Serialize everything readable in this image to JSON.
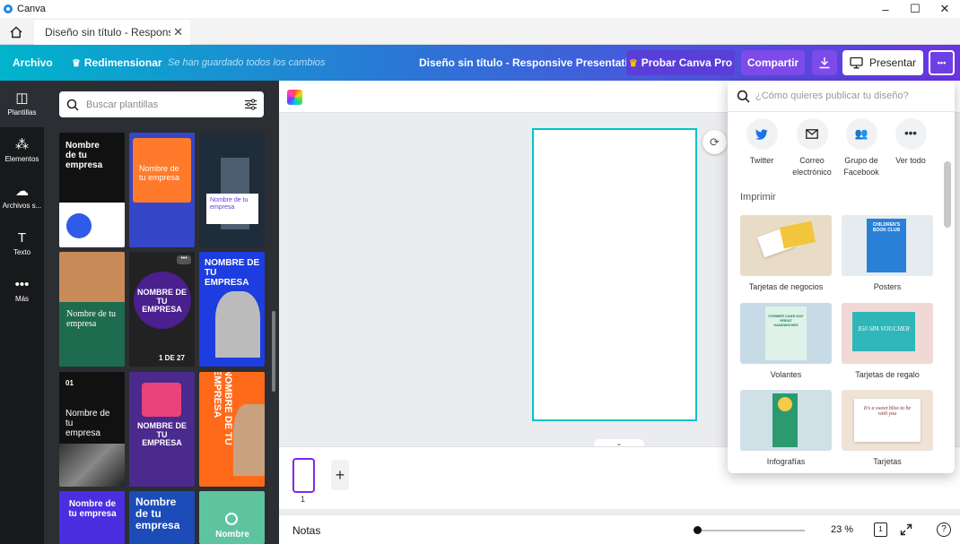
{
  "window": {
    "app_name": "Canva",
    "minimize": "–",
    "maximize": "☐",
    "close": "✕"
  },
  "tabbar": {
    "tab_title": "Diseño sin título - Responsive",
    "tab_close": "✕"
  },
  "topbar": {
    "file_menu": "Archivo",
    "resize": "Redimensionar",
    "saved_status": "Se han guardado todos los cambios",
    "doc_title": "Diseño sin título - Responsive Presentation",
    "try_pro": "Probar Canva Pro",
    "share": "Compartir",
    "present": "Presentar",
    "more": "•••",
    "colors": {
      "pro_button": "#5a3ed8",
      "share_button": "#7d4be9"
    }
  },
  "sidenav": {
    "items": [
      {
        "label": "Plantillas",
        "icon": "template-icon"
      },
      {
        "label": "Elementos",
        "icon": "shapes-icon"
      },
      {
        "label": "Archivos s...",
        "icon": "upload-cloud-icon"
      },
      {
        "label": "Texto",
        "icon": "text-icon"
      },
      {
        "label": "Más",
        "icon": "more-dots-icon"
      }
    ]
  },
  "templates": {
    "search_placeholder": "Buscar plantillas",
    "t1": "Nombre de tu empresa",
    "t2": "Nombre de tu empresa",
    "t3": "Nombre de tu empresa",
    "t4": "Nombre de tu empresa",
    "t5": "NOMBRE DE TU EMPRESA",
    "t5_counter": "1 DE 27",
    "t6": "NOMBRE DE TU EMPRESA",
    "t7_num": "01",
    "t7": "Nombre de tu empresa",
    "t8": "NOMBRE DE TU EMPRESA",
    "t9": "NOMBRE DE TU EMPRESA",
    "t10": "Nombre de tu empresa",
    "t11": "Nombre de tu empresa",
    "t12": "Nombre"
  },
  "canvas": {
    "page_number": "1",
    "add_page": "+",
    "collapse_chevron": "⌄",
    "panel_toggle": "‹"
  },
  "footer": {
    "notes": "Notas",
    "zoom": "23 %",
    "page_icon_num": "1",
    "help": "?"
  },
  "publish": {
    "search_placeholder": "¿Cómo quieres publicar tu diseño?",
    "share_options": [
      {
        "label": "Twitter",
        "icon": "twitter-icon"
      },
      {
        "label": "Correo electrónico",
        "icon": "mail-icon"
      },
      {
        "label": "Grupo de Facebook",
        "icon": "group-icon"
      },
      {
        "label": "Ver todo",
        "icon": "more-dots-icon"
      }
    ],
    "print_section": "Imprimir",
    "print_items": [
      {
        "label": "Tarjetas de negocios"
      },
      {
        "label": "Posters",
        "img_text": "CHILDREN'S BOOK CLUB"
      },
      {
        "label": "Volantes",
        "img_text": "FORMER CAKE DAY GREAT SANDWICHES"
      },
      {
        "label": "Tarjetas de regalo",
        "img_text": "$50 SPA VOUCHER"
      },
      {
        "label": "Infografías"
      },
      {
        "label": "Tarjetas",
        "img_text": "It's a sweet bliss to be with you"
      }
    ]
  }
}
